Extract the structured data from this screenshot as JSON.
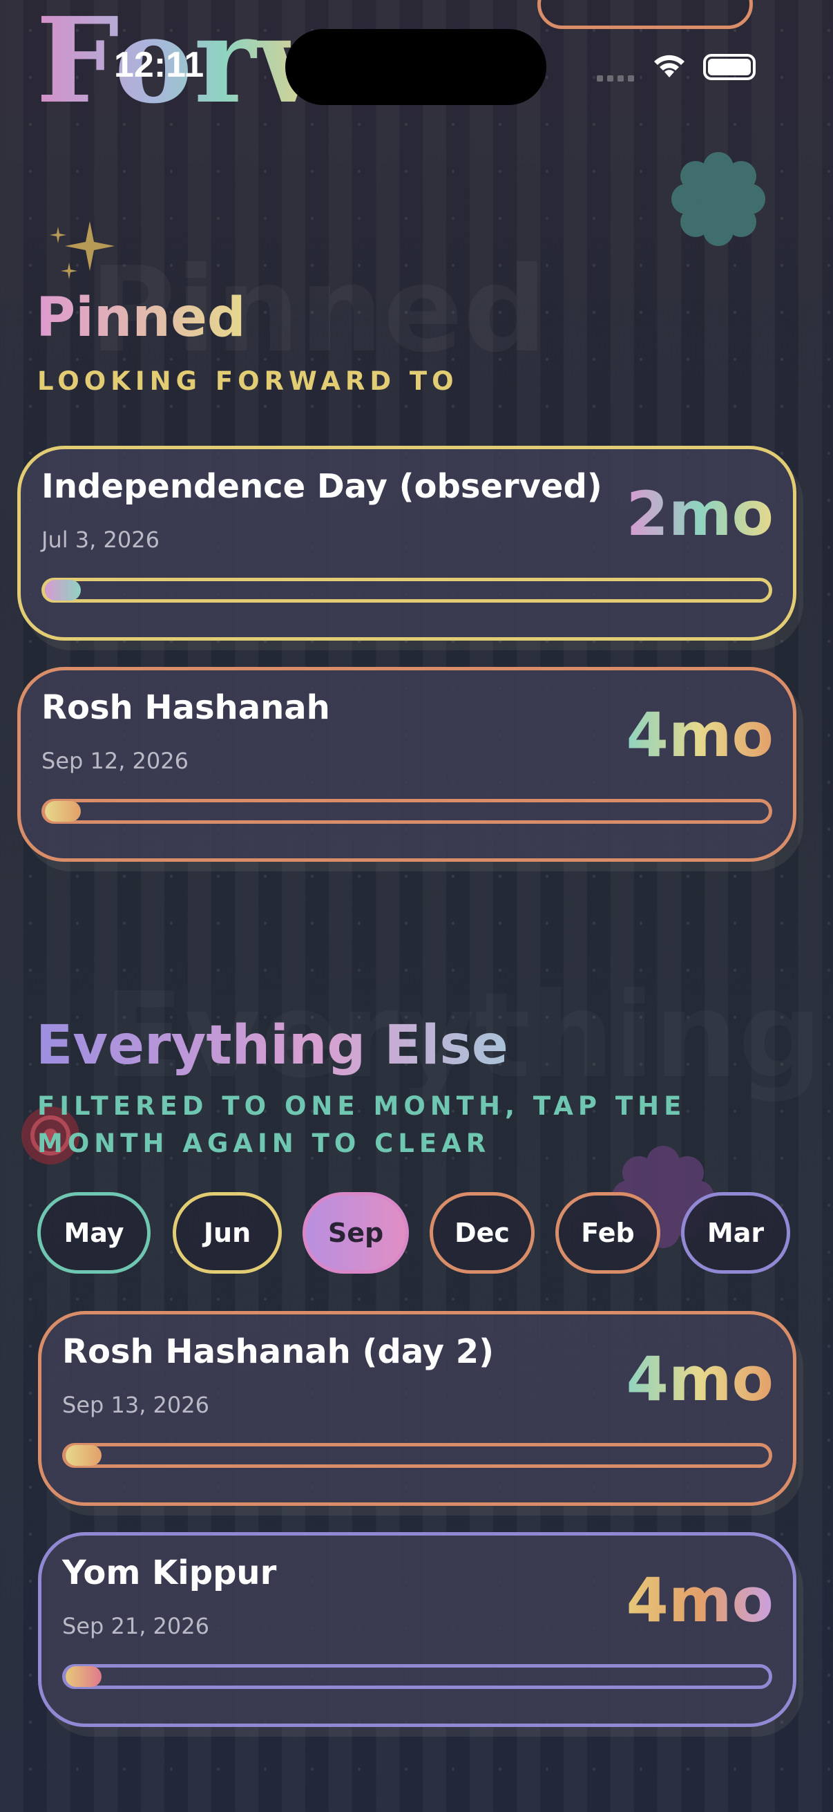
{
  "status_bar": {
    "time": "12:11"
  },
  "app": {
    "title": "Forward"
  },
  "pinned": {
    "title": "Pinned",
    "subtitle": "LOOKING FORWARD TO",
    "items": [
      {
        "name": "Independence Day (observed)",
        "date": "Jul 3, 2026",
        "countdown": "2mo",
        "progress": 0.02,
        "accent": "#e3cd74"
      },
      {
        "name": "Rosh Hashanah",
        "date": "Sep 12, 2026",
        "countdown": "4mo",
        "progress": 0.02,
        "accent": "#d98d68"
      }
    ]
  },
  "everything_else": {
    "title": "Everything Else",
    "subtitle": "FILTERED TO ONE MONTH, TAP THE MONTH AGAIN TO CLEAR",
    "months": [
      {
        "label": "May",
        "color": "#6fc7b1",
        "selected": false
      },
      {
        "label": "Jun",
        "color": "#e3cd74",
        "selected": false
      },
      {
        "label": "Sep",
        "color": "#d888c8",
        "selected": true
      },
      {
        "label": "Dec",
        "color": "#d98d68",
        "selected": false
      },
      {
        "label": "Feb",
        "color": "#d98d68",
        "selected": false
      },
      {
        "label": "Mar",
        "color": "#9189d4",
        "selected": false
      }
    ],
    "items": [
      {
        "name": "Rosh Hashanah (day 2)",
        "date": "Sep 13, 2026",
        "countdown": "4mo",
        "progress": 0.02,
        "accent": "#d98d68"
      },
      {
        "name": "Yom Kippur",
        "date": "Sep 21, 2026",
        "countdown": "4mo",
        "progress": 0.02,
        "accent": "#9189d4"
      }
    ]
  }
}
